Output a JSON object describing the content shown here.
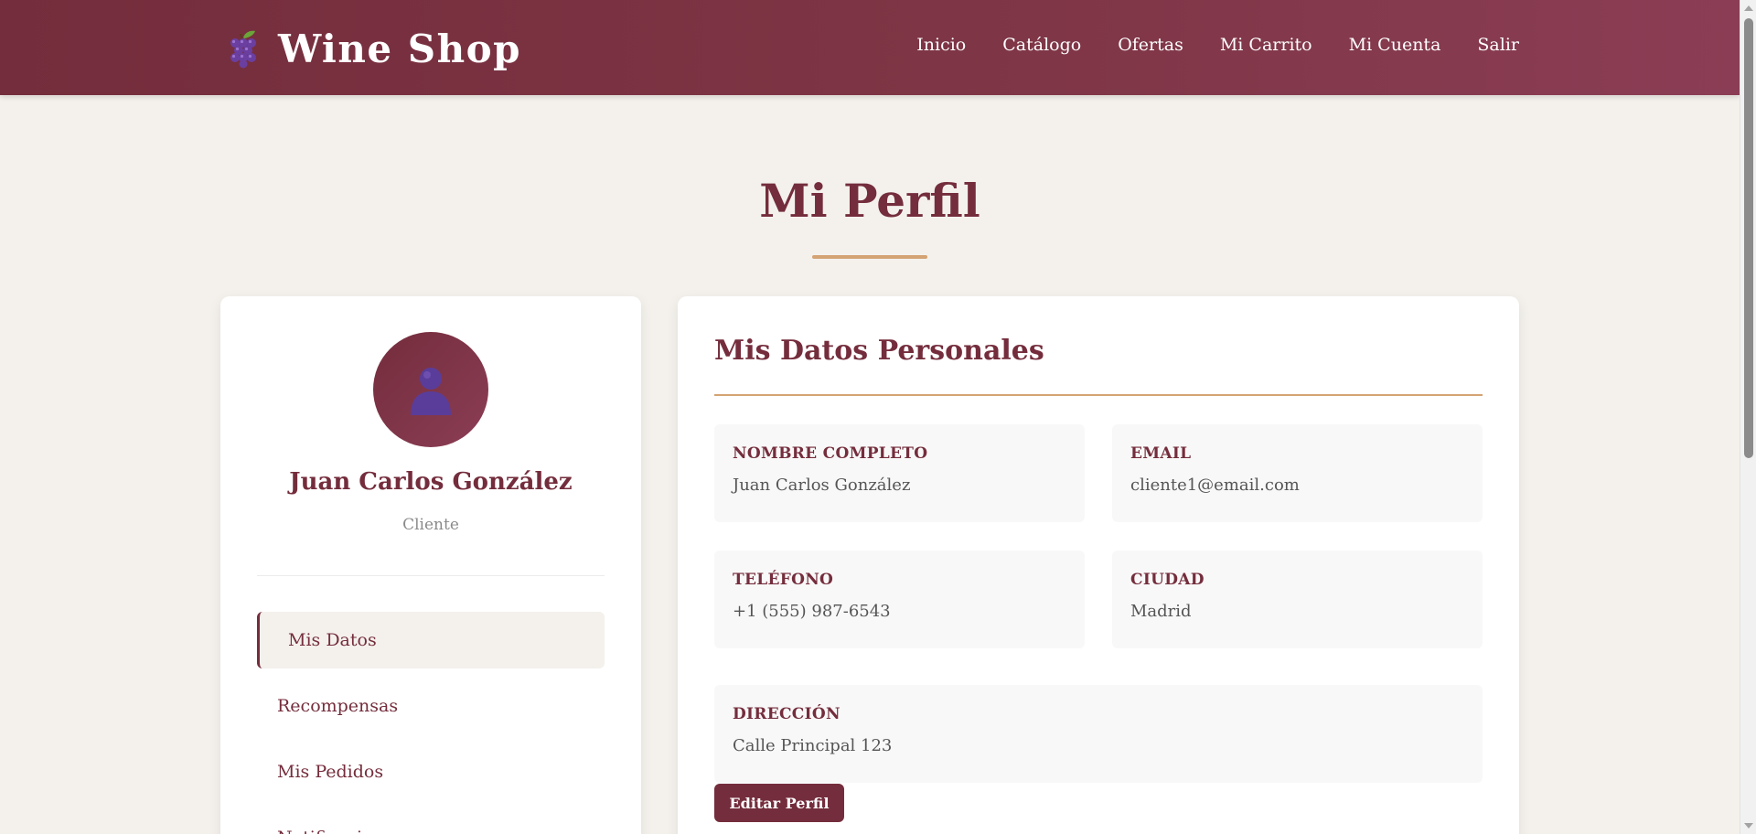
{
  "header": {
    "logo_text": "Wine Shop",
    "nav": [
      "Inicio",
      "Catálogo",
      "Ofertas",
      "Mi Carrito",
      "Mi Cuenta",
      "Salir"
    ]
  },
  "page": {
    "title": "Mi Perfil"
  },
  "sidebar": {
    "user_name": "Juan Carlos González",
    "user_role": "Cliente",
    "menu": [
      "Mis Datos",
      "Recompensas",
      "Mis Pedidos",
      "Notificaciones"
    ],
    "active_item": "Mis Datos"
  },
  "profile": {
    "section_title": "Mis Datos Personales",
    "fields": [
      {
        "label": "NOMBRE COMPLETO",
        "value": "Juan Carlos González"
      },
      {
        "label": "EMAIL",
        "value": "cliente1@email.com"
      },
      {
        "label": "TELÉFONO",
        "value": "+1 (555) 987-6543"
      },
      {
        "label": "CIUDAD",
        "value": "Madrid"
      },
      {
        "label": "DIRECCIÓN",
        "value": "Calle Principal 123"
      }
    ],
    "edit_button": "Editar Perfil"
  },
  "colors": {
    "brand": "#742d3c",
    "accent": "#d4a373",
    "background": "#f4f1ec"
  },
  "icons": {
    "logo": "grape-icon",
    "avatar": "person-icon"
  }
}
